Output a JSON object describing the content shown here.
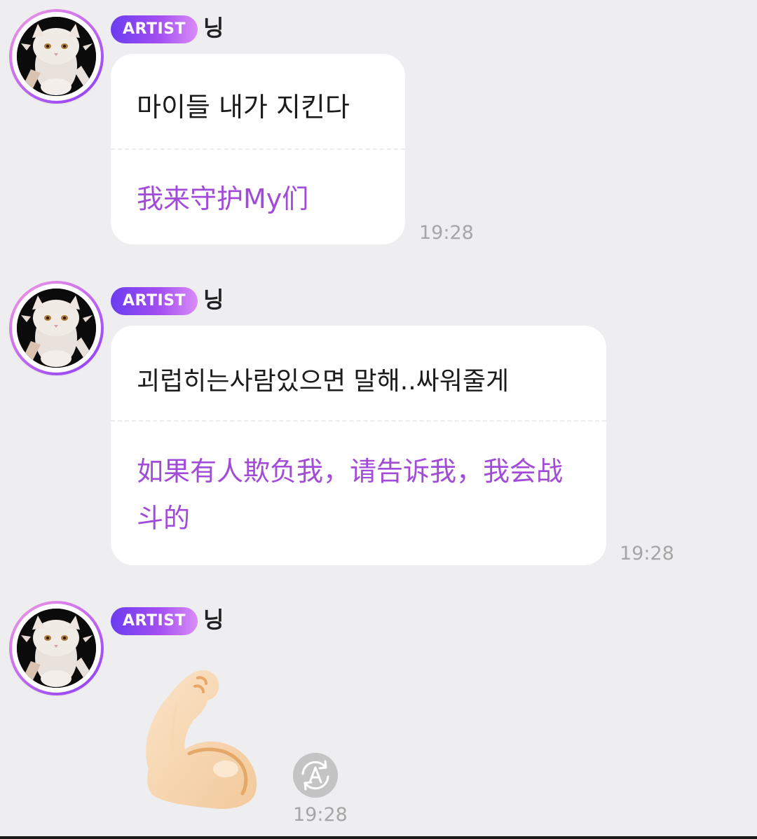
{
  "messages": [
    {
      "badge": "ARTIST",
      "sender": "닝",
      "text": "마이들 내가 지킨다",
      "translation": "我来守护My们",
      "time": "19:28"
    },
    {
      "badge": "ARTIST",
      "sender": "닝",
      "text": "괴럽히는사람있으면 말해..싸워줄게",
      "translation": "如果有人欺负我，请告诉我，我会战斗的",
      "time": "19:28"
    },
    {
      "badge": "ARTIST",
      "sender": "닝",
      "sticker_icon": "flexed-biceps-icon",
      "translate_icon": "auto-translate-icon",
      "time": "19:28"
    }
  ],
  "colors": {
    "background": "#eeeef0",
    "badge_gradient_start": "#6b3df0",
    "badge_gradient_end": "#d98cf7",
    "translation_text": "#a24bd9",
    "timestamp_text": "#a6a6a6"
  }
}
